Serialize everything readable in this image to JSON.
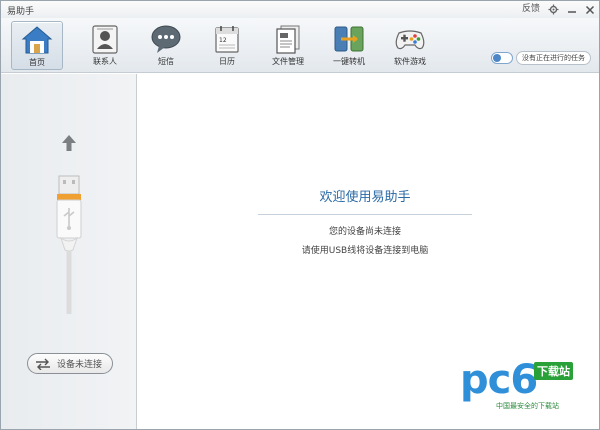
{
  "app": {
    "title": "易助手"
  },
  "titlebar": {
    "feedback": "反馈"
  },
  "nav": {
    "items": [
      {
        "label": "首页",
        "icon": "home-icon"
      },
      {
        "label": "联系人",
        "icon": "contacts-icon"
      },
      {
        "label": "短信",
        "icon": "sms-icon"
      },
      {
        "label": "日历",
        "icon": "calendar-icon"
      },
      {
        "label": "文件管理",
        "icon": "file-manager-icon"
      },
      {
        "label": "一键转机",
        "icon": "phone-transfer-icon"
      },
      {
        "label": "软件游戏",
        "icon": "gamepad-icon"
      }
    ],
    "active_index": 0
  },
  "tasks": {
    "status": "没有正在进行的任务"
  },
  "sidebar": {
    "connection_label": "设备未连接"
  },
  "main": {
    "welcome": "欢迎使用易助手",
    "line1": "您的设备尚未连接",
    "line2": "请使用USB线将设备连接到电脑"
  },
  "watermark": {
    "brand": "pc6",
    "badge": "下载站",
    "tagline": "中国最安全的下载站"
  },
  "colors": {
    "accent": "#2a6aa6",
    "border": "#9aa4ad"
  }
}
